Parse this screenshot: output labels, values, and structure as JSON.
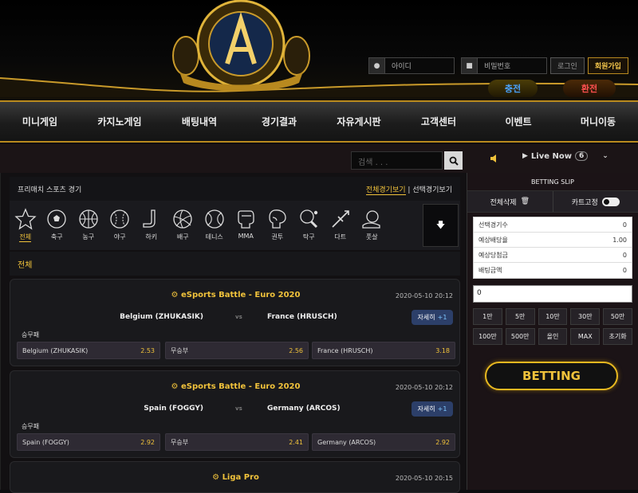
{
  "brand": {
    "logo_text": "LUXURY CASINO A"
  },
  "login": {
    "id_placeholder": "아이디",
    "pw_placeholder": "비밀번호",
    "login_label": "로그인",
    "join_label": "회원가입"
  },
  "wallet": {
    "deposit_label": "충전",
    "withdraw_label": "환전"
  },
  "nav": [
    "미니게임",
    "카지노게임",
    "배팅내역",
    "경기결과",
    "자유게시판",
    "고객센터",
    "이벤트",
    "머니이동"
  ],
  "search": {
    "placeholder": "검색 . . ."
  },
  "live": {
    "label": "Live Now",
    "count": "6"
  },
  "panel": {
    "title": "프리매치 스포츠 경기",
    "view_all": "전체경기보기",
    "separator": "|",
    "view_selected": "선택경기보기",
    "all_label": "전체"
  },
  "sports": [
    {
      "label": "전체",
      "icon": "star-icon"
    },
    {
      "label": "축구",
      "icon": "soccer-icon"
    },
    {
      "label": "농구",
      "icon": "basketball-icon"
    },
    {
      "label": "야구",
      "icon": "baseball-icon"
    },
    {
      "label": "하키",
      "icon": "hockey-icon"
    },
    {
      "label": "배구",
      "icon": "volleyball-icon"
    },
    {
      "label": "테니스",
      "icon": "tennis-icon"
    },
    {
      "label": "MMA",
      "icon": "mma-glove-icon"
    },
    {
      "label": "권투",
      "icon": "boxing-glove-icon"
    },
    {
      "label": "탁구",
      "icon": "table-tennis-icon"
    },
    {
      "label": "다트",
      "icon": "dart-icon"
    },
    {
      "label": "풋살",
      "icon": "futsal-icon"
    }
  ],
  "matches": [
    {
      "league": "eSports Battle - Euro 2020",
      "time": "2020-05-10 20:12",
      "home": "Belgium (ZHUKASIK)",
      "vs": "vs",
      "away": "France (HRUSCH)",
      "detail": "자세히",
      "plus": "+1",
      "market": "승무패",
      "odds": [
        {
          "name": "Belgium (ZHUKASIK)",
          "value": "2.53"
        },
        {
          "name": "무승부",
          "value": "2.56"
        },
        {
          "name": "France (HRUSCH)",
          "value": "3.18"
        }
      ]
    },
    {
      "league": "eSports Battle - Euro 2020",
      "time": "2020-05-10 20:12",
      "home": "Spain (FOGGY)",
      "vs": "vs",
      "away": "Germany (ARCOS)",
      "detail": "자세히",
      "plus": "+1",
      "market": "승무패",
      "odds": [
        {
          "name": "Spain (FOGGY)",
          "value": "2.92"
        },
        {
          "name": "무승부",
          "value": "2.41"
        },
        {
          "name": "Germany (ARCOS)",
          "value": "2.92"
        }
      ]
    },
    {
      "league": "Liga Pro",
      "time": "2020-05-10 20:15"
    }
  ],
  "slip": {
    "title": "BETTING SLIP",
    "clear_label": "전체삭제",
    "fix_label": "카트고정",
    "stats": [
      {
        "label": "선택경기수",
        "value": "0"
      },
      {
        "label": "예상배당율",
        "value": "1.00"
      },
      {
        "label": "예상당첨금",
        "value": "0"
      },
      {
        "label": "배팅금액",
        "value": "0"
      }
    ],
    "amount": "0",
    "chips": [
      "1만",
      "5만",
      "10만",
      "30만",
      "50만",
      "100만",
      "500만",
      "올인",
      "MAX",
      "초기화"
    ],
    "bet_label": "BETTING"
  },
  "colors": {
    "accent": "#f0c23b",
    "nav_border": "#b98a1e",
    "detail_btn": "#2c3f69"
  }
}
